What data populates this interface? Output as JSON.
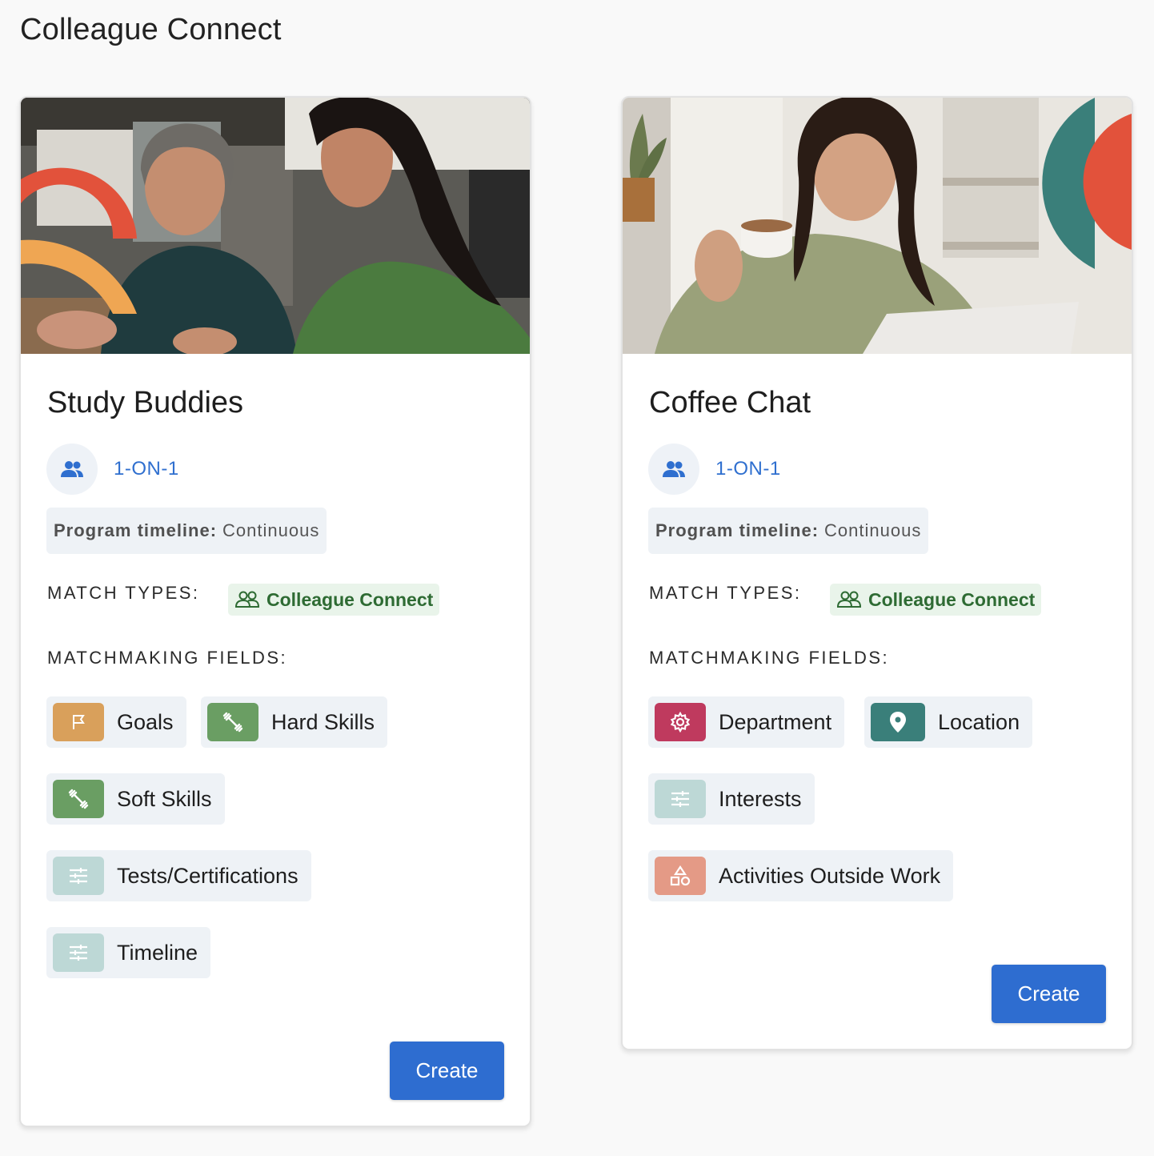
{
  "page": {
    "title": "Colleague Connect"
  },
  "cards": [
    {
      "title": "Study Buddies",
      "type_label": "1-ON-1",
      "timeline_label": "Program timeline:",
      "timeline_value": "Continuous",
      "match_types_label": "MATCH TYPES:",
      "match_type_chip": "Colleague Connect",
      "matchmaking_label": "MATCHMAKING FIELDS:",
      "fields": [
        {
          "label": "Goals",
          "icon": "flag-icon",
          "color": "#d9a05b"
        },
        {
          "label": "Hard Skills",
          "icon": "dumbbell-icon",
          "color": "#6a9e63"
        },
        {
          "label": "Soft Skills",
          "icon": "dumbbell-icon",
          "color": "#6a9e63"
        },
        {
          "label": "Tests/Certifications",
          "icon": "sliders-icon",
          "color": "#bdd8d6"
        },
        {
          "label": "Timeline",
          "icon": "sliders-icon",
          "color": "#bdd8d6"
        }
      ],
      "create_label": "Create"
    },
    {
      "title": "Coffee Chat",
      "type_label": "1-ON-1",
      "timeline_label": "Program timeline:",
      "timeline_value": "Continuous",
      "match_types_label": "MATCH TYPES:",
      "match_type_chip": "Colleague Connect",
      "matchmaking_label": "MATCHMAKING FIELDS:",
      "fields": [
        {
          "label": "Department",
          "icon": "gear-icon",
          "color": "#bf3a5e"
        },
        {
          "label": "Location",
          "icon": "location-pin-icon",
          "color": "#3a7f7a"
        },
        {
          "label": "Interests",
          "icon": "sliders-icon",
          "color": "#bdd8d6"
        },
        {
          "label": "Activities Outside Work",
          "icon": "shapes-icon",
          "color": "#e49a86"
        }
      ],
      "create_label": "Create"
    }
  ],
  "colors": {
    "accent": "#2e6dd0",
    "type_label": "#2f6fcf",
    "chip_text": "#2e6b33",
    "chip_bg": "#e9f4ea"
  }
}
